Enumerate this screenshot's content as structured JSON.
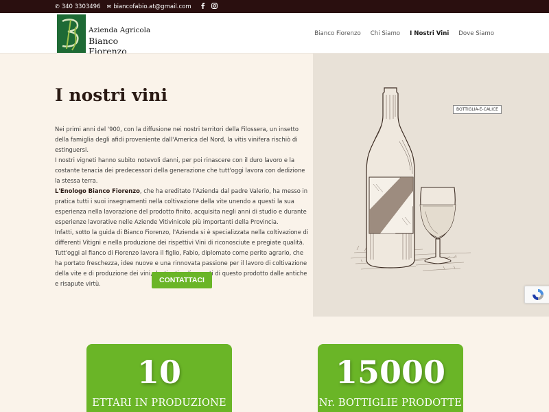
{
  "topbar": {
    "phone": "340 3303496",
    "email": "biancofabio.at@gmail.com",
    "social": [
      "facebook-icon",
      "instagram-icon"
    ]
  },
  "header": {
    "logo_line1": "Azienda Agricola",
    "logo_line2": "Bianco Fiorenzo",
    "nav": [
      {
        "label": "Bianco Fiorenzo"
      },
      {
        "label": "Chi Siamo"
      },
      {
        "label": "I Nostri Vini",
        "active": true
      },
      {
        "label": "Dove Siamo"
      }
    ]
  },
  "main": {
    "title": "I nostri vini",
    "paragraphs": [
      "Nei primi anni del '900, con la diffusione nei nostri territori della Filossera, un insetto della famiglia degli afidi proveniente dall'America del Nord, la vitis vinifera rischiò di estinguersi.",
      "I nostri vigneti hanno subito notevoli danni, per poi rinascere con il duro lavoro e la costante tenacia dei predecessori della generazione che tutt'oggi lavora con dedizione la stessa terra."
    ],
    "p3_bold": "L'Enologo Bianco Fiorenzo",
    "p3_rest": ", che ha ereditato l'Azienda dal padre Valerio, ha messo in pratica tutti i suoi insegnamenti nella coltivazione della vite unendo a questi la sua esperienza nella lavorazione del prodotto finito, acquisita negli anni di studio e durante esperienze lavorative nelle Aziende Vitivinicole più importanti della Provincia.",
    "paragraphs2": [
      "Infatti, sotto la guida di Bianco Fiorenzo, l'Azienda si è specializzata nella coltivazione di differenti Vitigni e nella produzione dei rispettivi Vini di riconosciute e pregiate qualità.",
      "Tutt'oggi al fianco di Fiorenzo lavora il figlio, Fabio, diplomato come perito agrario, che ha portato freschezza, idee nuove e una rinnovata passione per il lavoro di coltivazione della vite e di produzione dei vini, destinati agli amanti di questo prodotto dalle antiche e risapute virtù."
    ],
    "cta": "CONTATTACI",
    "image_caption": "BOTTIGLIA-E-CALICE"
  },
  "stats": [
    {
      "number": "10",
      "label": "ETTARI IN PRODUZIONE"
    },
    {
      "number": "15000",
      "label": "Nr. BOTTIGLIE PRODOTTE"
    }
  ],
  "colors": {
    "accent": "#6ab527",
    "topbar": "#2a0f0f",
    "background": "#faf3ea",
    "logo_green": "#1e6a35"
  }
}
